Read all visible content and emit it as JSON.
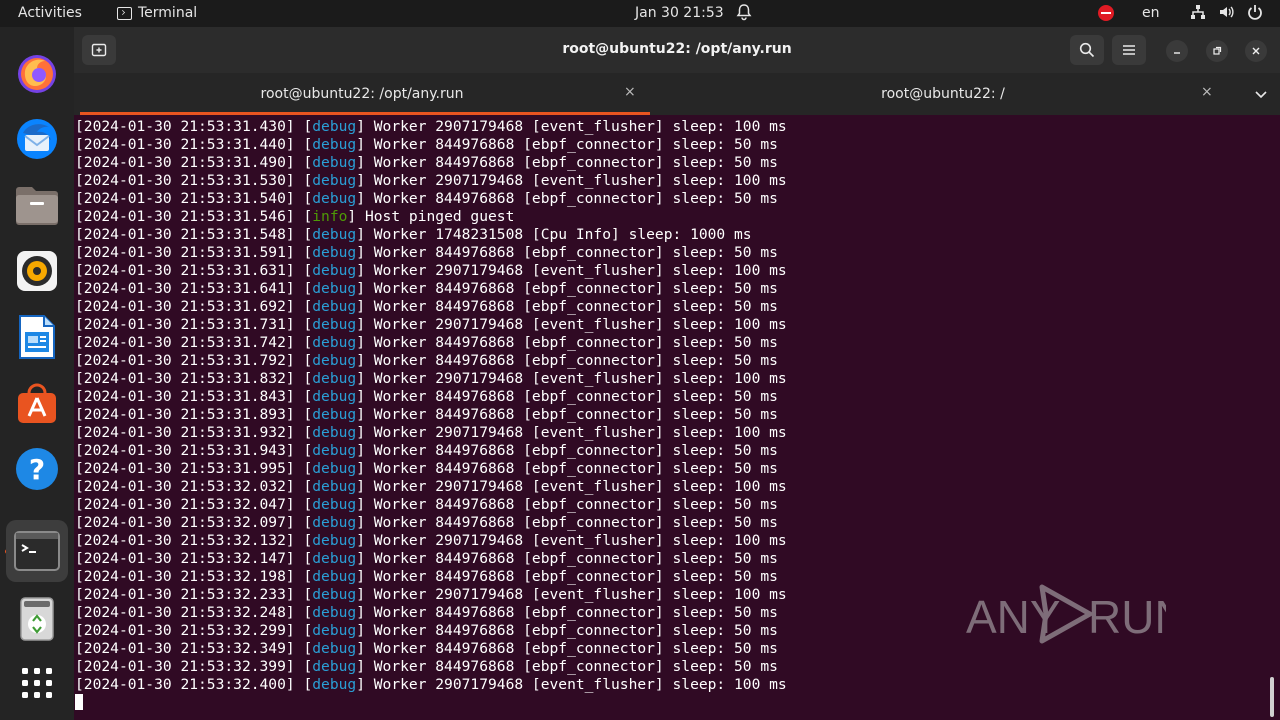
{
  "topbar": {
    "activities": "Activities",
    "app_name": "Terminal",
    "clock": "Jan 30  21:53",
    "language": "en"
  },
  "dock": {
    "items": [
      "firefox",
      "thunderbird",
      "files",
      "rhythmbox",
      "libreoffice-writer",
      "app-center",
      "help",
      "terminal",
      "trash",
      "show-apps"
    ]
  },
  "window": {
    "title": "root@ubuntu22: /opt/any.run",
    "tabs": [
      {
        "label": "root@ubuntu22: /opt/any.run",
        "close": "×"
      },
      {
        "label": "root@ubuntu22: /",
        "close": "×"
      }
    ]
  },
  "terminal": {
    "lines": [
      {
        "ts": "2024-01-30 21:53:31.430",
        "level": "debug",
        "msg": " Worker 2907179468 [event_flusher] sleep: 100 ms"
      },
      {
        "ts": "2024-01-30 21:53:31.440",
        "level": "debug",
        "msg": " Worker 844976868 [ebpf_connector] sleep: 50 ms"
      },
      {
        "ts": "2024-01-30 21:53:31.490",
        "level": "debug",
        "msg": " Worker 844976868 [ebpf_connector] sleep: 50 ms"
      },
      {
        "ts": "2024-01-30 21:53:31.530",
        "level": "debug",
        "msg": " Worker 2907179468 [event_flusher] sleep: 100 ms"
      },
      {
        "ts": "2024-01-30 21:53:31.540",
        "level": "debug",
        "msg": " Worker 844976868 [ebpf_connector] sleep: 50 ms"
      },
      {
        "ts": "2024-01-30 21:53:31.546",
        "level": "info",
        "msg": " Host pinged guest"
      },
      {
        "ts": "2024-01-30 21:53:31.548",
        "level": "debug",
        "msg": " Worker 1748231508 [Cpu Info] sleep: 1000 ms"
      },
      {
        "ts": "2024-01-30 21:53:31.591",
        "level": "debug",
        "msg": " Worker 844976868 [ebpf_connector] sleep: 50 ms"
      },
      {
        "ts": "2024-01-30 21:53:31.631",
        "level": "debug",
        "msg": " Worker 2907179468 [event_flusher] sleep: 100 ms"
      },
      {
        "ts": "2024-01-30 21:53:31.641",
        "level": "debug",
        "msg": " Worker 844976868 [ebpf_connector] sleep: 50 ms"
      },
      {
        "ts": "2024-01-30 21:53:31.692",
        "level": "debug",
        "msg": " Worker 844976868 [ebpf_connector] sleep: 50 ms"
      },
      {
        "ts": "2024-01-30 21:53:31.731",
        "level": "debug",
        "msg": " Worker 2907179468 [event_flusher] sleep: 100 ms"
      },
      {
        "ts": "2024-01-30 21:53:31.742",
        "level": "debug",
        "msg": " Worker 844976868 [ebpf_connector] sleep: 50 ms"
      },
      {
        "ts": "2024-01-30 21:53:31.792",
        "level": "debug",
        "msg": " Worker 844976868 [ebpf_connector] sleep: 50 ms"
      },
      {
        "ts": "2024-01-30 21:53:31.832",
        "level": "debug",
        "msg": " Worker 2907179468 [event_flusher] sleep: 100 ms"
      },
      {
        "ts": "2024-01-30 21:53:31.843",
        "level": "debug",
        "msg": " Worker 844976868 [ebpf_connector] sleep: 50 ms"
      },
      {
        "ts": "2024-01-30 21:53:31.893",
        "level": "debug",
        "msg": " Worker 844976868 [ebpf_connector] sleep: 50 ms"
      },
      {
        "ts": "2024-01-30 21:53:31.932",
        "level": "debug",
        "msg": " Worker 2907179468 [event_flusher] sleep: 100 ms"
      },
      {
        "ts": "2024-01-30 21:53:31.943",
        "level": "debug",
        "msg": " Worker 844976868 [ebpf_connector] sleep: 50 ms"
      },
      {
        "ts": "2024-01-30 21:53:31.995",
        "level": "debug",
        "msg": " Worker 844976868 [ebpf_connector] sleep: 50 ms"
      },
      {
        "ts": "2024-01-30 21:53:32.032",
        "level": "debug",
        "msg": " Worker 2907179468 [event_flusher] sleep: 100 ms"
      },
      {
        "ts": "2024-01-30 21:53:32.047",
        "level": "debug",
        "msg": " Worker 844976868 [ebpf_connector] sleep: 50 ms"
      },
      {
        "ts": "2024-01-30 21:53:32.097",
        "level": "debug",
        "msg": " Worker 844976868 [ebpf_connector] sleep: 50 ms"
      },
      {
        "ts": "2024-01-30 21:53:32.132",
        "level": "debug",
        "msg": " Worker 2907179468 [event_flusher] sleep: 100 ms"
      },
      {
        "ts": "2024-01-30 21:53:32.147",
        "level": "debug",
        "msg": " Worker 844976868 [ebpf_connector] sleep: 50 ms"
      },
      {
        "ts": "2024-01-30 21:53:32.198",
        "level": "debug",
        "msg": " Worker 844976868 [ebpf_connector] sleep: 50 ms"
      },
      {
        "ts": "2024-01-30 21:53:32.233",
        "level": "debug",
        "msg": " Worker 2907179468 [event_flusher] sleep: 100 ms"
      },
      {
        "ts": "2024-01-30 21:53:32.248",
        "level": "debug",
        "msg": " Worker 844976868 [ebpf_connector] sleep: 50 ms"
      },
      {
        "ts": "2024-01-30 21:53:32.299",
        "level": "debug",
        "msg": " Worker 844976868 [ebpf_connector] sleep: 50 ms"
      },
      {
        "ts": "2024-01-30 21:53:32.349",
        "level": "debug",
        "msg": " Worker 844976868 [ebpf_connector] sleep: 50 ms"
      },
      {
        "ts": "2024-01-30 21:53:32.399",
        "level": "debug",
        "msg": " Worker 844976868 [ebpf_connector] sleep: 50 ms"
      },
      {
        "ts": "2024-01-30 21:53:32.400",
        "level": "debug",
        "msg": " Worker 2907179468 [event_flusher] sleep: 100 ms"
      }
    ]
  },
  "watermark": {
    "text_left": "ANY",
    "text_right": "RUN"
  },
  "colors": {
    "terminal_bg": "#300a24",
    "debug": "#2a9fd6",
    "info": "#4e9a06",
    "accent": "#e95420"
  }
}
